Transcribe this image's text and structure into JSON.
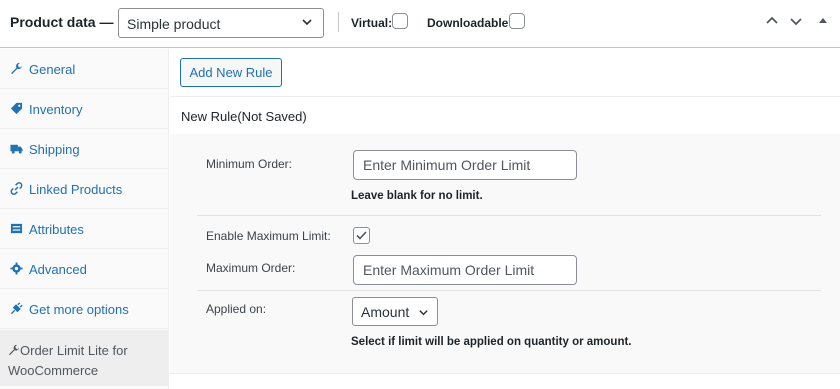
{
  "header": {
    "title": "Product data —",
    "product_type": "Simple product",
    "virtual_label": "Virtual:",
    "downloadable_label": "Downloadable:"
  },
  "sidebar": {
    "items": [
      {
        "label": "General",
        "icon": "wrench-icon"
      },
      {
        "label": "Inventory",
        "icon": "tag-icon"
      },
      {
        "label": "Shipping",
        "icon": "truck-icon"
      },
      {
        "label": "Linked Products",
        "icon": "link-icon"
      },
      {
        "label": "Attributes",
        "icon": "list-icon"
      },
      {
        "label": "Advanced",
        "icon": "gear-icon"
      },
      {
        "label": "Get more options",
        "icon": "plugin-icon"
      },
      {
        "label": "Order Limit Lite for WooCommerce",
        "icon": "wrench-icon"
      }
    ]
  },
  "main": {
    "add_rule_label": "Add New Rule",
    "rule_title": "New Rule(Not Saved)",
    "min_order_label": "Minimum Order:",
    "min_order_placeholder": "Enter Minimum Order Limit",
    "min_order_hint": "Leave blank for no limit.",
    "enable_max_label": "Enable Maximum Limit:",
    "enable_max_checked": true,
    "max_order_label": "Maximum Order:",
    "max_order_placeholder": "Enter Maximum Order Limit",
    "applied_on_label": "Applied on:",
    "applied_on_value": "Amount",
    "applied_on_hint": "Select if limit will be applied on quantity or amount."
  },
  "colors": {
    "link": "#2271b1",
    "border": "#8c8f94",
    "text": "#1d2327"
  }
}
